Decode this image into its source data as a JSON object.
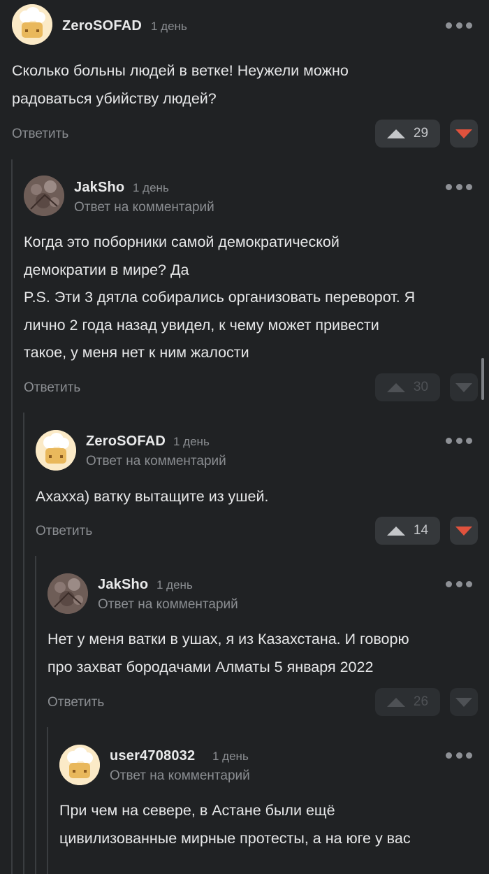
{
  "comments": [
    {
      "username": "ZeroSOFAD",
      "time": "1 день",
      "reply_to": "",
      "text_lines": [
        "Сколько больны людей в ветке! Неужели можно",
        "радоваться убийству людей?"
      ],
      "reply_label": "Ответить",
      "votes": "29",
      "avatar": "chef-hat-avatar"
    },
    {
      "username": "JakSho",
      "time": "1 день",
      "reply_to": "Ответ на комментарий",
      "text_lines": [
        "Когда это поборники самой демократической",
        "демократии в мире? Да",
        "P.S. Эти 3 дятла собирались организовать переворот. Я",
        "лично 2 года назад увидел, к чему может привести",
        "такое, у меня нет к ним жалости"
      ],
      "reply_label": "Ответить",
      "votes": "30",
      "avatar": "tree-branch-avatar"
    },
    {
      "username": "ZeroSOFAD",
      "time": "1 день",
      "reply_to": "Ответ на комментарий",
      "text_lines": [
        "Ахахха) ватку вытащите из ушей."
      ],
      "reply_label": "Ответить",
      "votes": "14",
      "avatar": "chef-hat-avatar"
    },
    {
      "username": "JakSho",
      "time": "1 день",
      "reply_to": "Ответ на комментарий",
      "text_lines": [
        "Нет у меня ватки в ушах, я из Казахстана. И говорю",
        "про захват бородачами Алматы 5 января 2022"
      ],
      "reply_label": "Ответить",
      "votes": "26",
      "avatar": "tree-branch-avatar"
    },
    {
      "username": "user4708032",
      "time": "1 день",
      "reply_to": "Ответ на комментарий",
      "text_lines": [
        "При чем на севере, в Астане были ещё",
        "цивилизованные мирные протесты, а на юге у вас"
      ],
      "avatar": "chef-hat-avatar"
    }
  ],
  "colors": {
    "downvote_active": "#e0523d",
    "background": "#202224"
  }
}
